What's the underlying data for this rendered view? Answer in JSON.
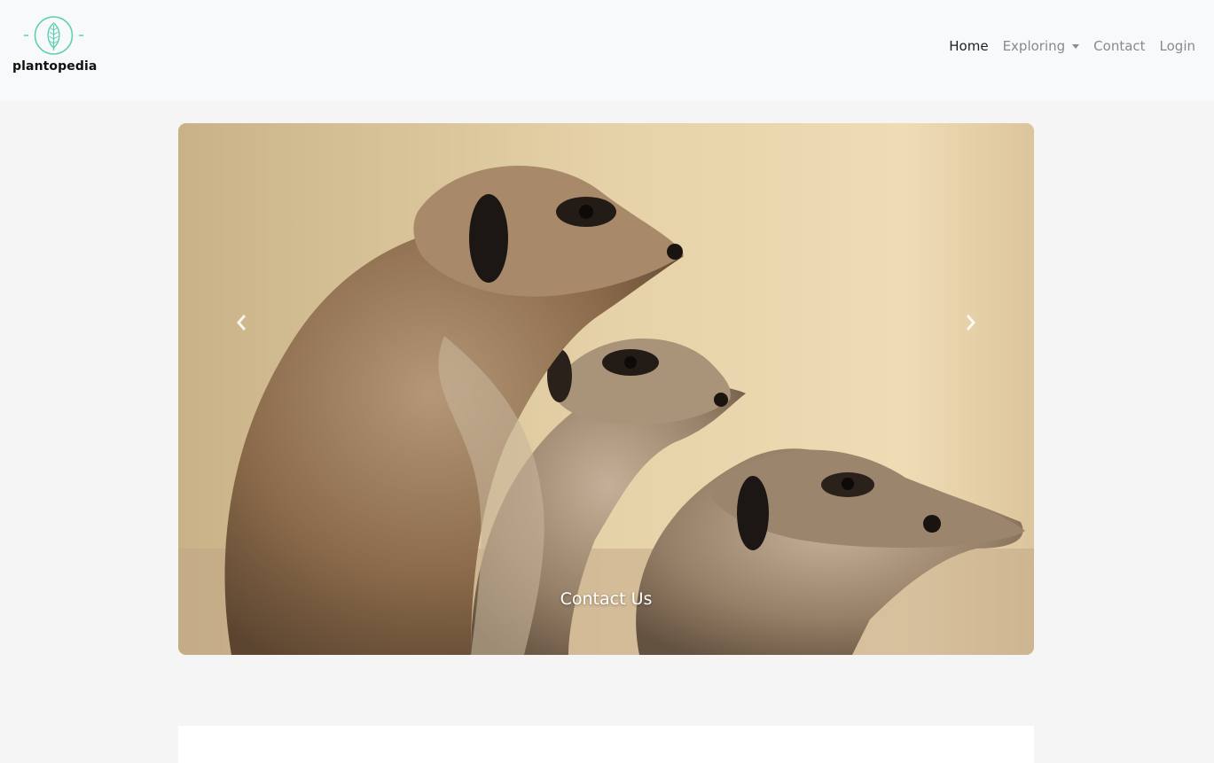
{
  "brand": {
    "name": "plantopedia",
    "logo_icon": "leaf-icon",
    "accent": "#5ccfb2"
  },
  "nav": {
    "home": "Home",
    "exploring": "Exploring",
    "contact": "Contact",
    "login": "Login"
  },
  "carousel": {
    "caption": "Contact Us",
    "prev_icon": "chevron-left-icon",
    "next_icon": "chevron-right-icon"
  },
  "colors": {
    "navbar_bg": "#f8f9fa",
    "page_bg": "#f5f5f5",
    "nav_active": "#1f1f1f",
    "nav_muted": "#8a8a8a"
  }
}
